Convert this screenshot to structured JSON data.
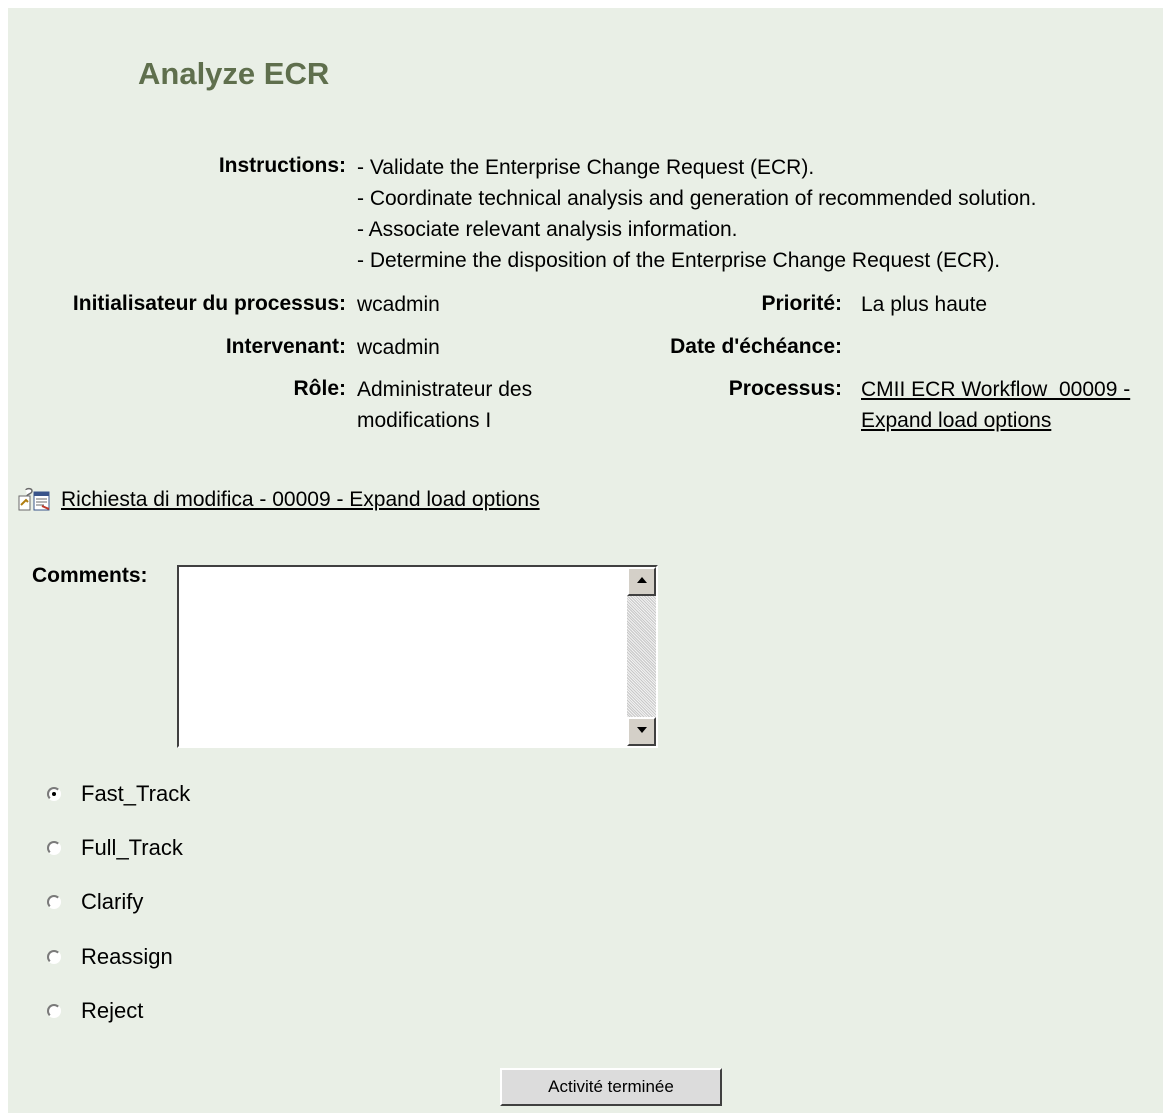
{
  "page_title": "Analyze ECR",
  "details": {
    "instructions_label": "Instructions:",
    "instructions": [
      "- Validate the Enterprise Change Request (ECR).",
      "- Coordinate technical analysis and generation of recommended solution.",
      "- Associate relevant analysis information.",
      "- Determine the disposition of the Enterprise Change Request (ECR)."
    ],
    "initiator_label": "Initialisateur du processus:",
    "initiator_value": "wcadmin",
    "priority_label": "Priorité:",
    "priority_value": "La plus haute",
    "assignee_label": "Intervenant:",
    "assignee_value": "wcadmin",
    "due_date_label": "Date d'échéance:",
    "due_date_value": "",
    "role_label": "Rôle:",
    "role_value_line1": "Administrateur des",
    "role_value_line2": "modifications I",
    "process_label": "Processus:",
    "process_link_line1": "CMII ECR Workflow_00009 -",
    "process_link_line2": "Expand load options"
  },
  "primary_object": {
    "icon": "change-request-icon",
    "link_text": "Richiesta di modifica - 00009 - Expand load options"
  },
  "comments": {
    "label": "Comments:",
    "value": ""
  },
  "routing_options": [
    {
      "label": "Fast_Track",
      "selected": true
    },
    {
      "label": "Full_Track",
      "selected": false
    },
    {
      "label": "Clarify",
      "selected": false
    },
    {
      "label": "Reassign",
      "selected": false
    },
    {
      "label": "Reject",
      "selected": false
    }
  ],
  "complete_button_label": "Activité terminée",
  "colors": {
    "background": "#e9efe6",
    "title": "#5f6f4d"
  }
}
